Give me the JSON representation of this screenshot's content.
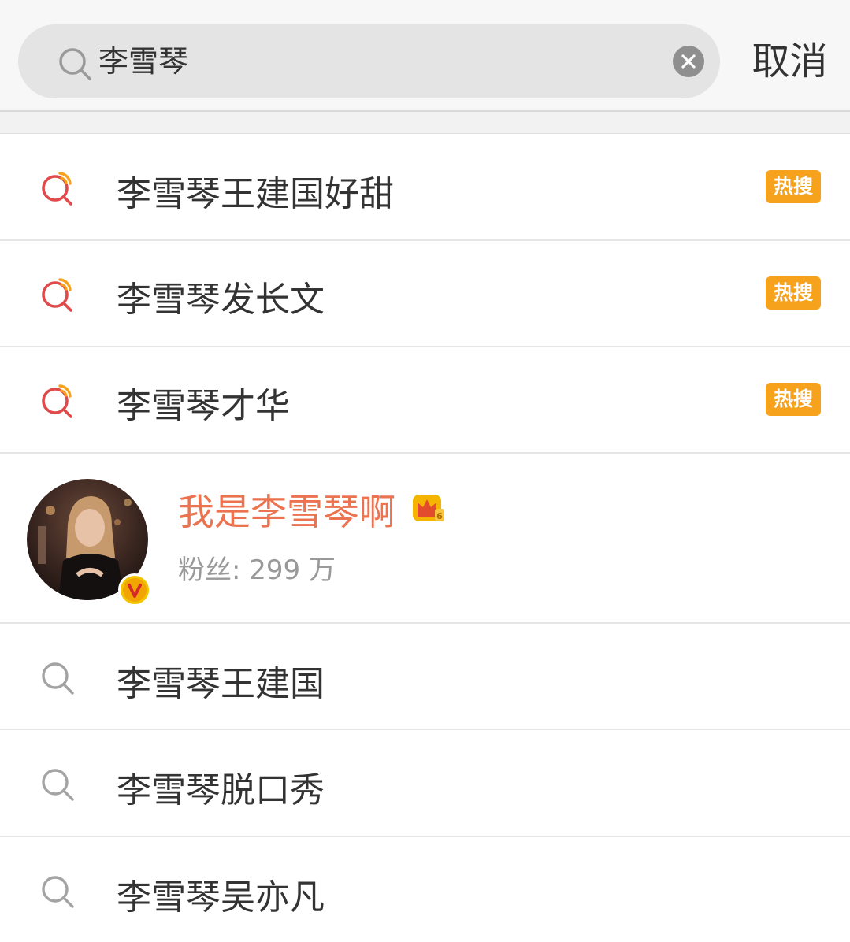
{
  "search": {
    "query": "李雪琴",
    "cancel_label": "取消"
  },
  "hot_suggestions": [
    {
      "label": "李雪琴王建国好甜",
      "badge": "热搜"
    },
    {
      "label": "李雪琴发长文",
      "badge": "热搜"
    },
    {
      "label": "李雪琴才华",
      "badge": "热搜"
    }
  ],
  "user_result": {
    "name": "我是李雪琴啊",
    "followers_label": "粉丝: 299 万",
    "verified_icon": "verified-v-icon",
    "crown_icon": "crown-icon"
  },
  "suggestions": [
    {
      "label": "李雪琴王建国"
    },
    {
      "label": "李雪琴脱口秀"
    },
    {
      "label": "李雪琴吴亦凡"
    }
  ],
  "colors": {
    "hot_badge": "#f7a21c",
    "user_name": "#eb7350",
    "hot_icon_red": "#e04a4a",
    "hot_icon_orange": "#f7a21c"
  }
}
